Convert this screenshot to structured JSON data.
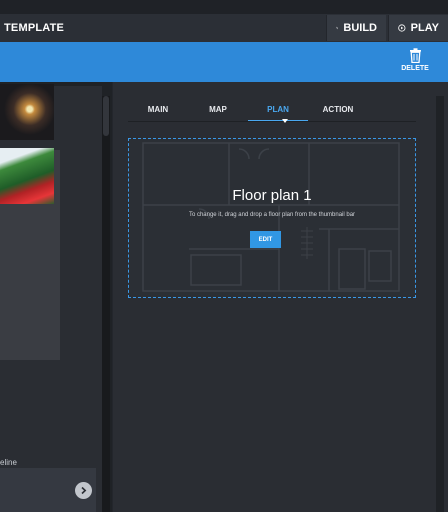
{
  "header": {
    "title": "TEMPLATE",
    "build_label": "BUILD",
    "play_label": "PLAY"
  },
  "toolbar": {
    "delete_label": "DELETE"
  },
  "left": {
    "timeline_label": "eline"
  },
  "tabs": [
    {
      "label": "MAIN"
    },
    {
      "label": "MAP"
    },
    {
      "label": "PLAN",
      "active": true
    },
    {
      "label": "ACTION"
    }
  ],
  "floorplan": {
    "title": "Floor plan 1",
    "subtitle": "To change it, drag and drop a floor plan from the thumbnail bar",
    "edit_label": "EDIT"
  },
  "colors": {
    "accent": "#2e89d9",
    "header_bg": "#2b2f36",
    "panel_bg": "#2a2d33",
    "active_tab": "#4aa8f0"
  }
}
